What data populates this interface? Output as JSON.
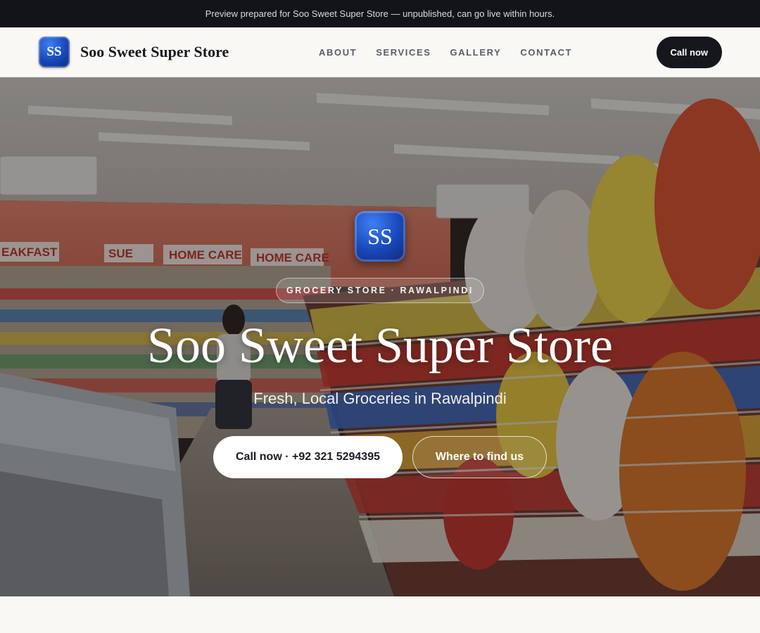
{
  "topbar": {
    "text": "Preview prepared for Soo Sweet Super Store — unpublished, can go live within hours."
  },
  "header": {
    "logo_text": "SS",
    "brand_name": "Soo Sweet Super Store",
    "nav": [
      {
        "label": "ABOUT"
      },
      {
        "label": "SERVICES"
      },
      {
        "label": "GALLERY"
      },
      {
        "label": "CONTACT"
      }
    ],
    "cta_label": "Call now"
  },
  "hero": {
    "logo_text": "SS",
    "tagline": "GROCERY STORE · RAWALPINDI",
    "title": "Soo Sweet Super Store",
    "subtitle": "Fresh, Local Groceries in Rawalpindi",
    "primary_button": "Call now · +92 321 5294395",
    "secondary_button": "Where to find us",
    "background_signs": [
      "EAKFAST",
      "SUE",
      "HOME CARE",
      "HOME CARE"
    ]
  },
  "colors": {
    "topbar_bg": "#12141a",
    "nav_bg": "#faf8f4",
    "accent_dark": "#15171d",
    "logo_blue": "#1847b8",
    "hero_text": "#ffffff"
  }
}
